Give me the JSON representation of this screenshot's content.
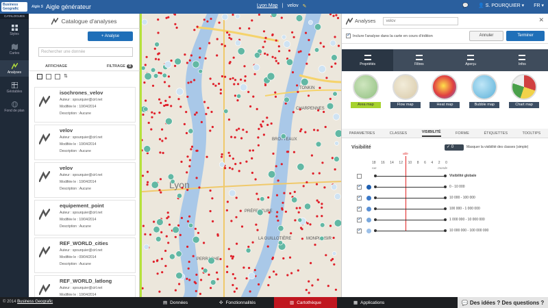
{
  "topbar": {
    "logo_line1": "Business",
    "logo_line2": "Geografic",
    "brand": "Aigle S",
    "title": "Aigle générateur",
    "map_link": "Lyon Map",
    "map_sep": "|",
    "analysis": "velov",
    "user": "S. POURQUIER",
    "lang": "FR"
  },
  "sidebar": {
    "header": "CATALOGUES",
    "items": [
      {
        "label": "Styles",
        "icon": "styles-icon"
      },
      {
        "label": "Cartes",
        "icon": "map-icon"
      },
      {
        "label": "Analyses",
        "icon": "analyses-icon",
        "active": true
      },
      {
        "label": "Géotables",
        "icon": "table-icon"
      },
      {
        "label": "Fond de plan",
        "icon": "globe-icon"
      }
    ]
  },
  "catalog": {
    "title": "Catalogue d'analyses",
    "add_label": "+ Analyse",
    "search_placeholder": "Rechercher une donnée",
    "tab_display": "AFFICHAGE",
    "tab_filter": "FILTRAGE",
    "filter_count": "0",
    "items": [
      {
        "name": "isochrones_velov",
        "author": "Auteur : spourquier@cirl.net",
        "modified": "Modifiée le : 10/04/2014",
        "description": "Description : Aucune"
      },
      {
        "name": "velov",
        "author": "Auteur : spourquier@cirl.net",
        "modified": "Modifiée le : 10/04/2014",
        "description": "Description : Aucune"
      },
      {
        "name": "velov",
        "author": "Auteur : spourquier@cirl.net",
        "modified": "Modifiée le : 10/04/2014",
        "description": "Description : Aucune"
      },
      {
        "name": "equipement_point",
        "author": "Auteur : spourquier@cirl.net",
        "modified": "Modifiée le : 10/04/2014",
        "description": "Description : Aucune"
      },
      {
        "name": "REF_WORLD_cities",
        "author": "Auteur : spourquier@cirl.net",
        "modified": "Modifiée le : 09/04/2014",
        "description": "Description : Aucune"
      },
      {
        "name": "REF_WORLD_latlong",
        "author": "Auteur : spourquier@cirl.net",
        "modified": "Modifiée le : 10/04/2014",
        "description": ""
      }
    ]
  },
  "map": {
    "city_label": "Lyon",
    "streets": [
      "Boulevard de la Croix-Rousse",
      "Boulevard des Belges",
      "Boulevard du 11 Novembre 1918",
      "Quai Pierre Scize",
      "Cours Lafayette",
      "TONKIN",
      "CHARPENNES",
      "BROTTEAUX",
      "PRÉFECTURE",
      "LA GUILLOTIÈRE",
      "PERRACHE",
      "MONPLAISIR"
    ]
  },
  "rpanel": {
    "head_label": "Analyses",
    "name_value": "velov",
    "include_label": "Inclure l'analyse dans la carte en cours d'édition",
    "cancel": "Annuler",
    "finish": "Terminer",
    "main_tabs": [
      "Propriétés",
      "Filtres",
      "Aperçu",
      "Infos"
    ],
    "types": [
      {
        "label": "Area map",
        "selected": true,
        "color": "#8fbf7f"
      },
      {
        "label": "Flow map",
        "color": "#d8c9a8"
      },
      {
        "label": "Heat map",
        "color": "#e04040"
      },
      {
        "label": "Bubble map",
        "color": "#5ab0d8"
      },
      {
        "label": "Chart map",
        "color": "#d04040"
      }
    ],
    "sub_tabs": [
      "PARAMETRES",
      "CLASSES",
      "VISIBILITÉ",
      "FORME",
      "ÉTIQUETTES",
      "TOOLTIPS"
    ],
    "visibility": {
      "title": "Visibilité",
      "toggle": "✓ 0",
      "mask_label": "Masquer la visibilité des classes (simple)",
      "scale": [
        "18",
        "16",
        "14",
        "12",
        "10",
        "8",
        "6",
        "4",
        "2",
        "0"
      ],
      "scale_left": "rue",
      "scale_right": "monde",
      "marker": "ville",
      "rows": [
        {
          "label": "Visibilité globale",
          "color": "",
          "bold": true
        },
        {
          "label": "0 - 10 000",
          "color": "#1f5fb0"
        },
        {
          "label": "10 000 - 100 000",
          "color": "#3a78c8"
        },
        {
          "label": "100 000 - 1 000 000",
          "color": "#5a90d4"
        },
        {
          "label": "1 000 000 - 10 000 000",
          "color": "#7aa8dc"
        },
        {
          "label": "10 000 000 - 100 000 000",
          "color": "#9cc0e8"
        }
      ]
    }
  },
  "bottom": {
    "copyright": "© 2014",
    "company": "Business Geografic",
    "items": [
      "Données",
      "Fonctionnalités",
      "Cartothèque",
      "Applications"
    ],
    "help": "Des idées ? Des questions ?"
  }
}
